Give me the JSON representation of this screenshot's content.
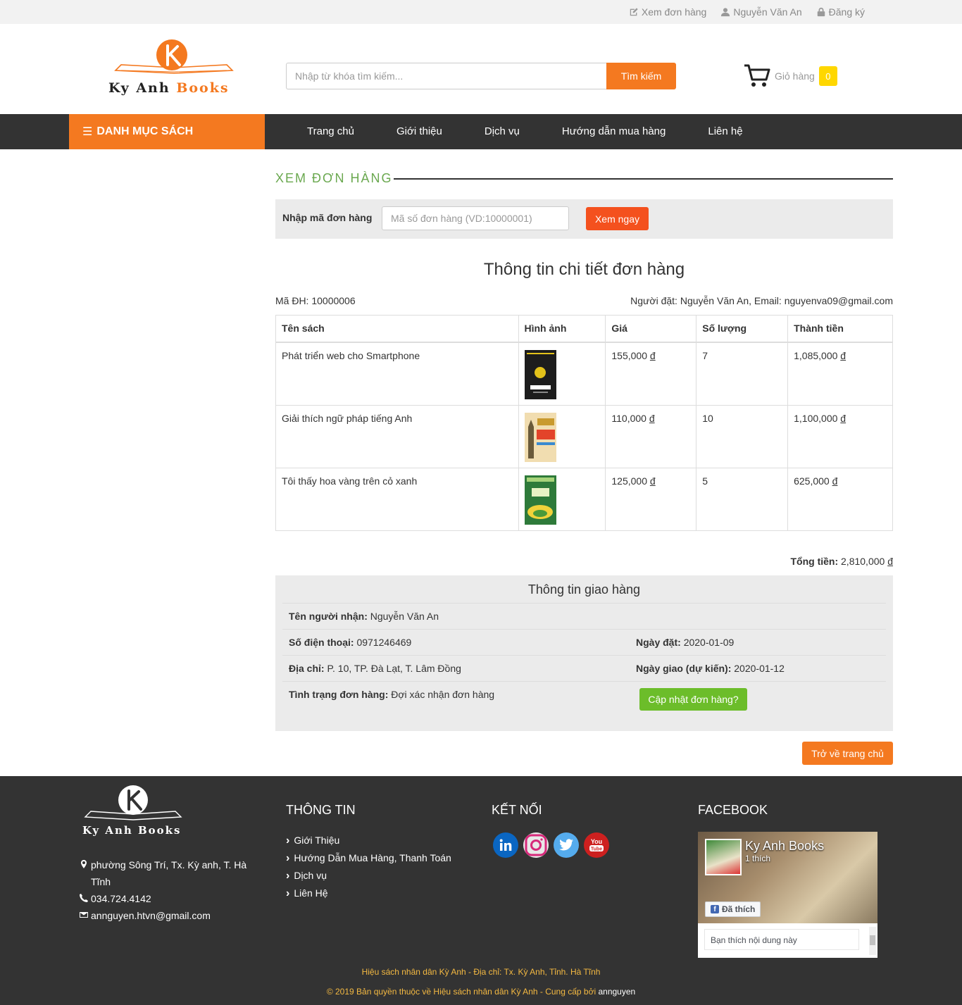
{
  "topbar": {
    "view_orders": "Xem đơn hàng",
    "user_name": "Nguyễn Văn An",
    "register": "Đăng ký"
  },
  "header": {
    "logo_text_1": "Ky Anh",
    "logo_text_2": "Books",
    "search_placeholder": "Nhập từ khóa tìm kiếm...",
    "search_button": "Tìm kiếm",
    "cart_label": "Giỏ hàng",
    "cart_count": "0"
  },
  "nav": {
    "category_label": "DANH MỤC SÁCH",
    "items": [
      "Trang chủ",
      "Giới thiệu",
      "Dịch vụ",
      "Hướng dẫn mua hàng",
      "Liên hệ"
    ]
  },
  "order_lookup": {
    "section_title": "XEM ĐƠN HÀNG",
    "label": "Nhập mã đơn hàng",
    "placeholder": "Mã số đơn hàng (VD:10000001)",
    "button": "Xem ngay"
  },
  "order": {
    "title": "Thông tin chi tiết đơn hàng",
    "code_label": "Mã ĐH: 10000006",
    "buyer_label": "Người đặt: Nguyễn Văn An, Email: nguyenva09@gmail.com",
    "columns": [
      "Tên sách",
      "Hình ảnh",
      "Giá",
      "Số lượng",
      "Thành tiền"
    ],
    "currency": "đ",
    "rows": [
      {
        "name": "Phát triển web cho Smartphone",
        "price": "155,000",
        "qty": "7",
        "subtotal": "1,085,000",
        "cover_color": "#1d1d1d",
        "cover_accent": "#e3c21a"
      },
      {
        "name": "Giải thích ngữ pháp tiếng Anh",
        "price": "110,000",
        "qty": "10",
        "subtotal": "1,100,000",
        "cover_color": "#f1ddb0",
        "cover_accent": "#e3442a"
      },
      {
        "name": "Tôi thấy hoa vàng trên cỏ xanh",
        "price": "125,000",
        "qty": "5",
        "subtotal": "625,000",
        "cover_color": "#2e7a3a",
        "cover_accent": "#f0d23a"
      }
    ],
    "total_label": "Tổng tiền:",
    "total_value": "2,810,000"
  },
  "shipping": {
    "title": "Thông tin giao hàng",
    "recipient_label": "Tên người nhận:",
    "recipient_value": "Nguyễn Văn An",
    "phone_label": "Số điện thoại:",
    "phone_value": "0971246469",
    "order_date_label": "Ngày đặt:",
    "order_date_value": "2020-01-09",
    "address_label": "Địa chỉ:",
    "address_value": "P. 10, TP. Đà Lạt, T. Lâm Đồng",
    "delivery_label": "Ngày giao (dự kiến):",
    "delivery_value": "2020-01-12",
    "status_label": "Tình trạng đơn hàng:",
    "status_value": "Đợi xác nhận đơn hàng",
    "update_button": "Cập nhật đơn hàng?"
  },
  "back_button": "Trở về trang chủ",
  "footer": {
    "logo_text": "Ky Anh Books",
    "address": "phường Sông Trí, Tx. Kỳ anh, T. Hà Tĩnh",
    "phone": "034.724.4142",
    "email": "annguyen.htvn@gmail.com",
    "info_heading": "THÔNG TIN",
    "info_links": [
      "Giới Thiệu",
      "Hướng Dẫn Mua Hàng, Thanh Toán",
      "Dịch vụ",
      "Liên Hệ"
    ],
    "connect_heading": "KẾT NỐI",
    "facebook_heading": "FACEBOOK",
    "fb_page_name": "Ky Anh Books",
    "fb_likes": "1 thích",
    "fb_liked_button": "Đã thích",
    "fb_comment": "Bạn thích nội dung này",
    "bottom_line_1": "Hiệu sách nhân dân Kỳ Anh - Địa chỉ: Tx. Kỳ Anh, Tỉnh. Hà Tĩnh",
    "bottom_line_2": "© 2019 Bản quyền thuộc về Hiệu sách nhân dân Kỳ Anh - Cung cấp bởi",
    "bottom_author": "annguyen"
  },
  "colors": {
    "brand_orange": "#f47920",
    "green": "#6cbd2a",
    "nav_dark": "#333333"
  }
}
